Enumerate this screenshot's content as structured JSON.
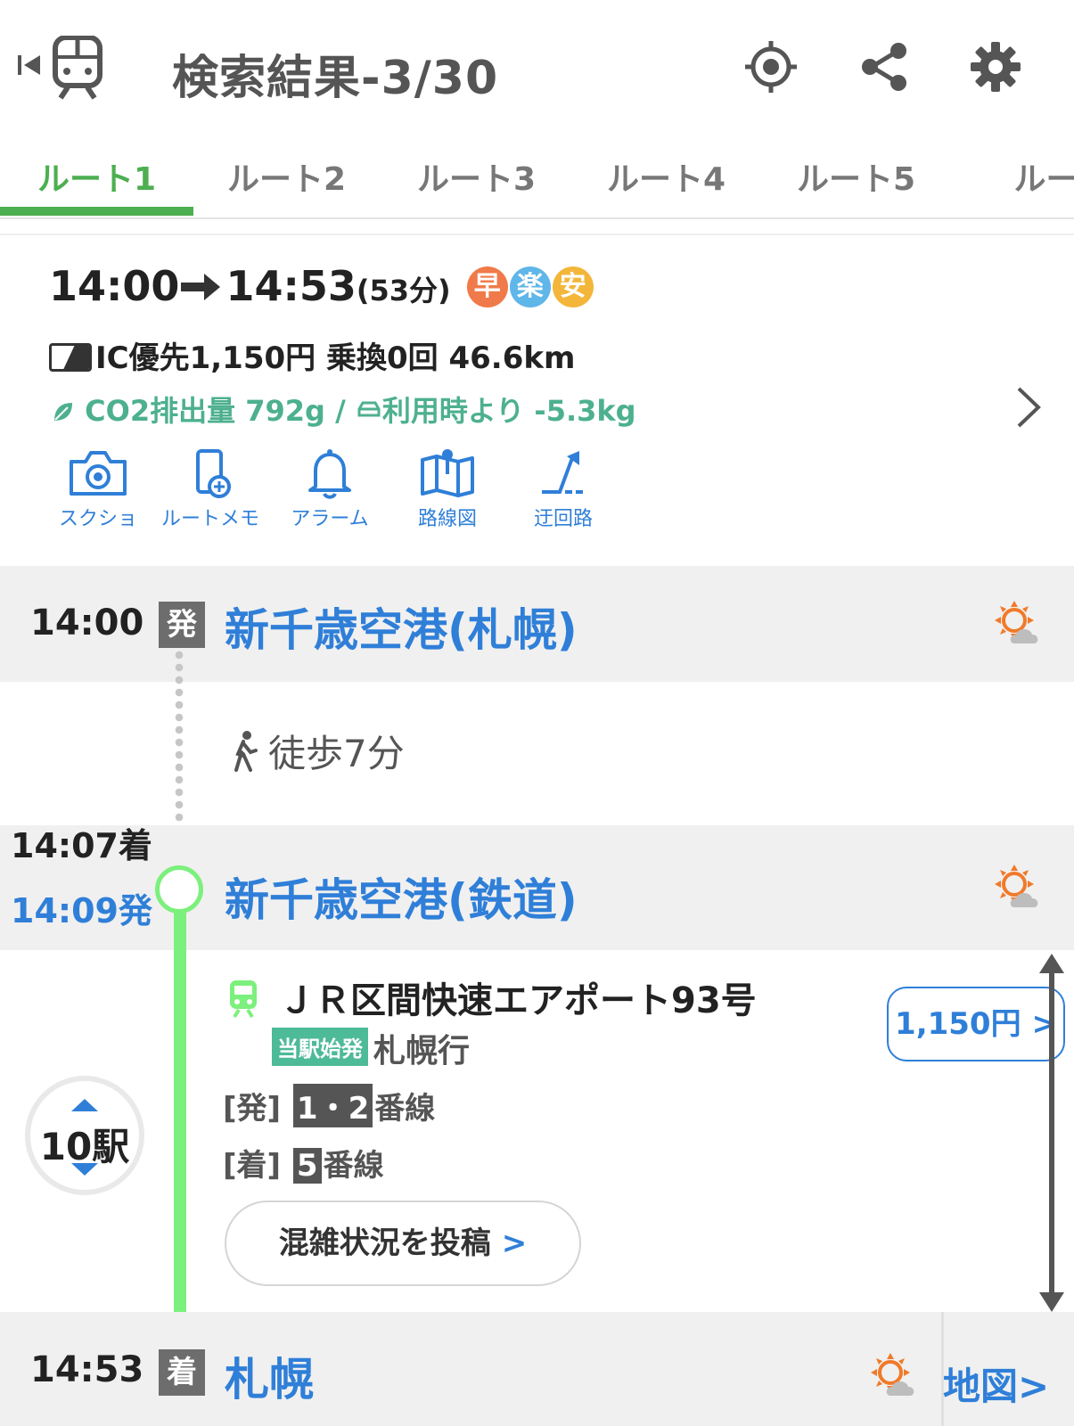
{
  "header": {
    "title": "検索結果-3/30",
    "icons": [
      "skip-back-icon",
      "train-icon",
      "location-target-icon",
      "share-icon",
      "gear-icon"
    ]
  },
  "tabs": [
    {
      "label": "ルート1",
      "active": true
    },
    {
      "label": "ルート2",
      "active": false
    },
    {
      "label": "ルート3",
      "active": false
    },
    {
      "label": "ルート4",
      "active": false
    },
    {
      "label": "ルート5",
      "active": false
    },
    {
      "label": "ルー",
      "active": false
    }
  ],
  "summary": {
    "depart": "14:00",
    "arrive": "14:53",
    "duration": "(53分)",
    "badges": [
      {
        "label": "早",
        "color": "#f07a4a"
      },
      {
        "label": "楽",
        "color": "#5fb6e8"
      },
      {
        "label": "安",
        "color": "#f3b63a"
      }
    ],
    "fare_line": "IC優先1,150円 乗換0回 46.6km",
    "co2_line": "CO2排出量 792g / 利用時より -5.3kg",
    "co2_prefix": "CO2排出量 792g /",
    "co2_suffix": "利用時より -5.3kg"
  },
  "actions": [
    {
      "label": "スクショ",
      "icon": "camera-icon"
    },
    {
      "label": "ルートメモ",
      "icon": "memo-add-icon"
    },
    {
      "label": "アラーム",
      "icon": "bell-icon"
    },
    {
      "label": "路線図",
      "icon": "route-map-icon"
    },
    {
      "label": "迂回路",
      "icon": "detour-icon"
    }
  ],
  "stations": {
    "origin": {
      "time": "14:00",
      "marker": "発",
      "name": "新千歳空港(札幌)"
    },
    "walk": "徒歩7分",
    "transfer": {
      "arrive": "14:07着",
      "depart": "14:09発",
      "name": "新千歳空港(鉄道)"
    },
    "destination": {
      "time": "14:53",
      "marker": "着",
      "name": "札幌"
    }
  },
  "train": {
    "name": "ＪＲ区間快速エアポート93号",
    "origin_badge": "当駅始発",
    "destination": "札幌行",
    "dep_label": "[発]",
    "dep_platform": "1・2",
    "arr_label": "[着]",
    "arr_platform": "5",
    "platform_suffix": "番線",
    "fare": "1,150円",
    "stops": "10駅",
    "congestion_button": "混雑状況を投稿"
  },
  "map_link": "地図",
  "colors": {
    "accent_green": "#4caf50",
    "link_blue": "#2f7fd8",
    "line_green": "#7cf07c",
    "co2_green": "#4db08e"
  }
}
